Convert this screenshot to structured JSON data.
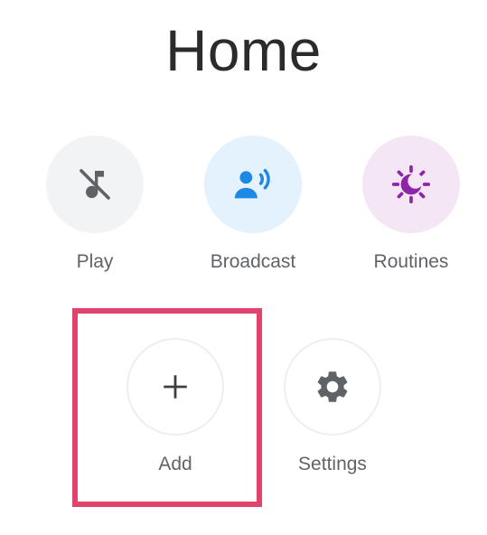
{
  "header": {
    "title": "Home"
  },
  "actions": {
    "play": {
      "label": "Play"
    },
    "broadcast": {
      "label": "Broadcast"
    },
    "routines": {
      "label": "Routines"
    },
    "add": {
      "label": "Add"
    },
    "settings": {
      "label": "Settings"
    }
  },
  "icons": {
    "play": "music-off-icon",
    "broadcast": "broadcast-icon",
    "routines": "routines-icon",
    "add": "plus-icon",
    "settings": "gear-icon"
  },
  "colors": {
    "play_icon": "#5f6368",
    "broadcast_icon": "#1e88e5",
    "routines_icon": "#8e24aa",
    "highlight": "#e0436b"
  }
}
